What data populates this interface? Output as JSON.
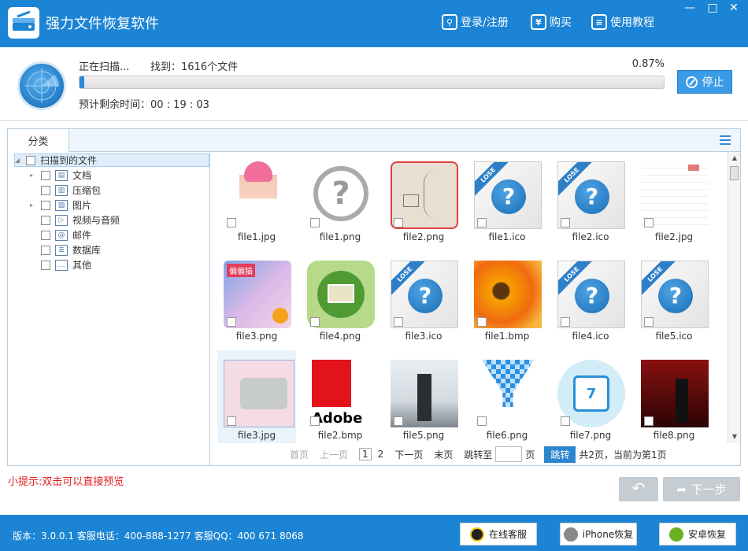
{
  "app": {
    "title": "强力文件恢复软件",
    "login_label": "登录/注册",
    "buy_label": "购买",
    "tutorial_label": "使用教程",
    "colors": {
      "brand": "#1c84d4",
      "accent": "#3a9be6",
      "tip": "#e02020"
    }
  },
  "scan": {
    "status": "正在扫描...",
    "found": "找到：1616个文件",
    "percent_text": "0.87%",
    "progress": 0.0087,
    "remaining": "预计剩余时间：00 : 19 : 03",
    "stop_label": "停止"
  },
  "tabs": {
    "category": "分类"
  },
  "tree": {
    "root": "扫描到的文件",
    "items": [
      {
        "label": "文档",
        "icon": "document-icon",
        "expandable": true
      },
      {
        "label": "压缩包",
        "icon": "archive-icon",
        "expandable": false
      },
      {
        "label": "图片",
        "icon": "image-icon",
        "expandable": true
      },
      {
        "label": "视频与音频",
        "icon": "media-icon",
        "expandable": false
      },
      {
        "label": "邮件",
        "icon": "mail-icon",
        "expandable": false
      },
      {
        "label": "数据库",
        "icon": "database-icon",
        "expandable": false
      },
      {
        "label": "其他",
        "icon": "other-icon",
        "expandable": false
      }
    ]
  },
  "files": [
    {
      "name": "file1.jpg",
      "kind": "photo"
    },
    {
      "name": "file1.png",
      "kind": "unknown"
    },
    {
      "name": "file2.png",
      "kind": "sketch"
    },
    {
      "name": "file1.ico",
      "kind": "lost"
    },
    {
      "name": "file2.ico",
      "kind": "lost"
    },
    {
      "name": "file2.jpg",
      "kind": "table"
    },
    {
      "name": "file3.png",
      "kind": "anime"
    },
    {
      "name": "file4.png",
      "kind": "gallery"
    },
    {
      "name": "file3.ico",
      "kind": "lost"
    },
    {
      "name": "file1.bmp",
      "kind": "flower"
    },
    {
      "name": "file4.ico",
      "kind": "lost"
    },
    {
      "name": "file5.ico",
      "kind": "lost"
    },
    {
      "name": "file3.jpg",
      "kind": "typewriter"
    },
    {
      "name": "file2.bmp",
      "kind": "adobe"
    },
    {
      "name": "file5.png",
      "kind": "movie"
    },
    {
      "name": "file6.png",
      "kind": "pixel"
    },
    {
      "name": "file7.png",
      "kind": "calendar"
    },
    {
      "name": "file8.png",
      "kind": "concert"
    }
  ],
  "thumb_text": {
    "lose": "LOSE",
    "adobe": "Adobe",
    "calendar_day": "7",
    "anime": "偏偏猫"
  },
  "pager": {
    "first": "首页",
    "prev": "上一页",
    "page1": "1",
    "page2": "2",
    "next": "下一页",
    "last": "末页",
    "jump_to": "跳转至",
    "page_unit": "页",
    "jump_btn": "跳转",
    "summary": "共2页，当前为第1页"
  },
  "tip": "小提示:双击可以直接预览",
  "next_label": "下一步",
  "status": {
    "info": "版本：3.0.0.1 客服电话：400-888-1277    客服QQ：400 671 8068",
    "online_service": "在线客服",
    "iphone_recovery": "iPhone恢复",
    "android_recovery": "安卓恢复"
  }
}
